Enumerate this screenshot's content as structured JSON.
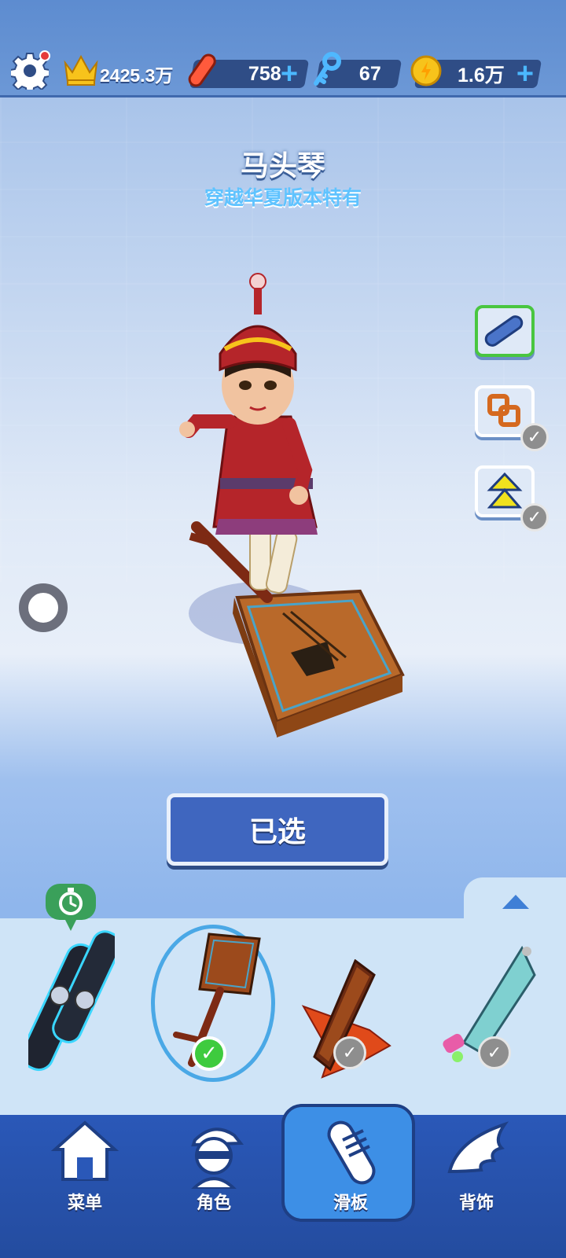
{
  "topbar": {
    "settings_icon": "gear-icon",
    "score": "2425.3万",
    "hoverboards": "758",
    "keys": "67",
    "coins": "1.6万",
    "plus": "+"
  },
  "board": {
    "name": "马头琴",
    "subtitle": "穿越华夏版本特有"
  },
  "side_options": [
    {
      "icon": "board-icon",
      "selected": true
    },
    {
      "icon": "double-coin-icon",
      "owned": true
    },
    {
      "icon": "super-jump-icon",
      "owned": true
    }
  ],
  "select_button": "已选",
  "carousel": [
    {
      "name": "tech-board",
      "badge": "timer-icon"
    },
    {
      "name": "matouqin-board",
      "selected": true
    },
    {
      "name": "dragon-boat-board",
      "owned": true
    },
    {
      "name": "rocket-board",
      "owned": true
    }
  ],
  "nav": {
    "menu": "菜单",
    "character": "角色",
    "board": "滑板",
    "accessory": "背饰"
  },
  "colors": {
    "accent": "#3f66bf",
    "selected_green": "#3ecb3e",
    "nav_bg": "#2a58b8"
  }
}
